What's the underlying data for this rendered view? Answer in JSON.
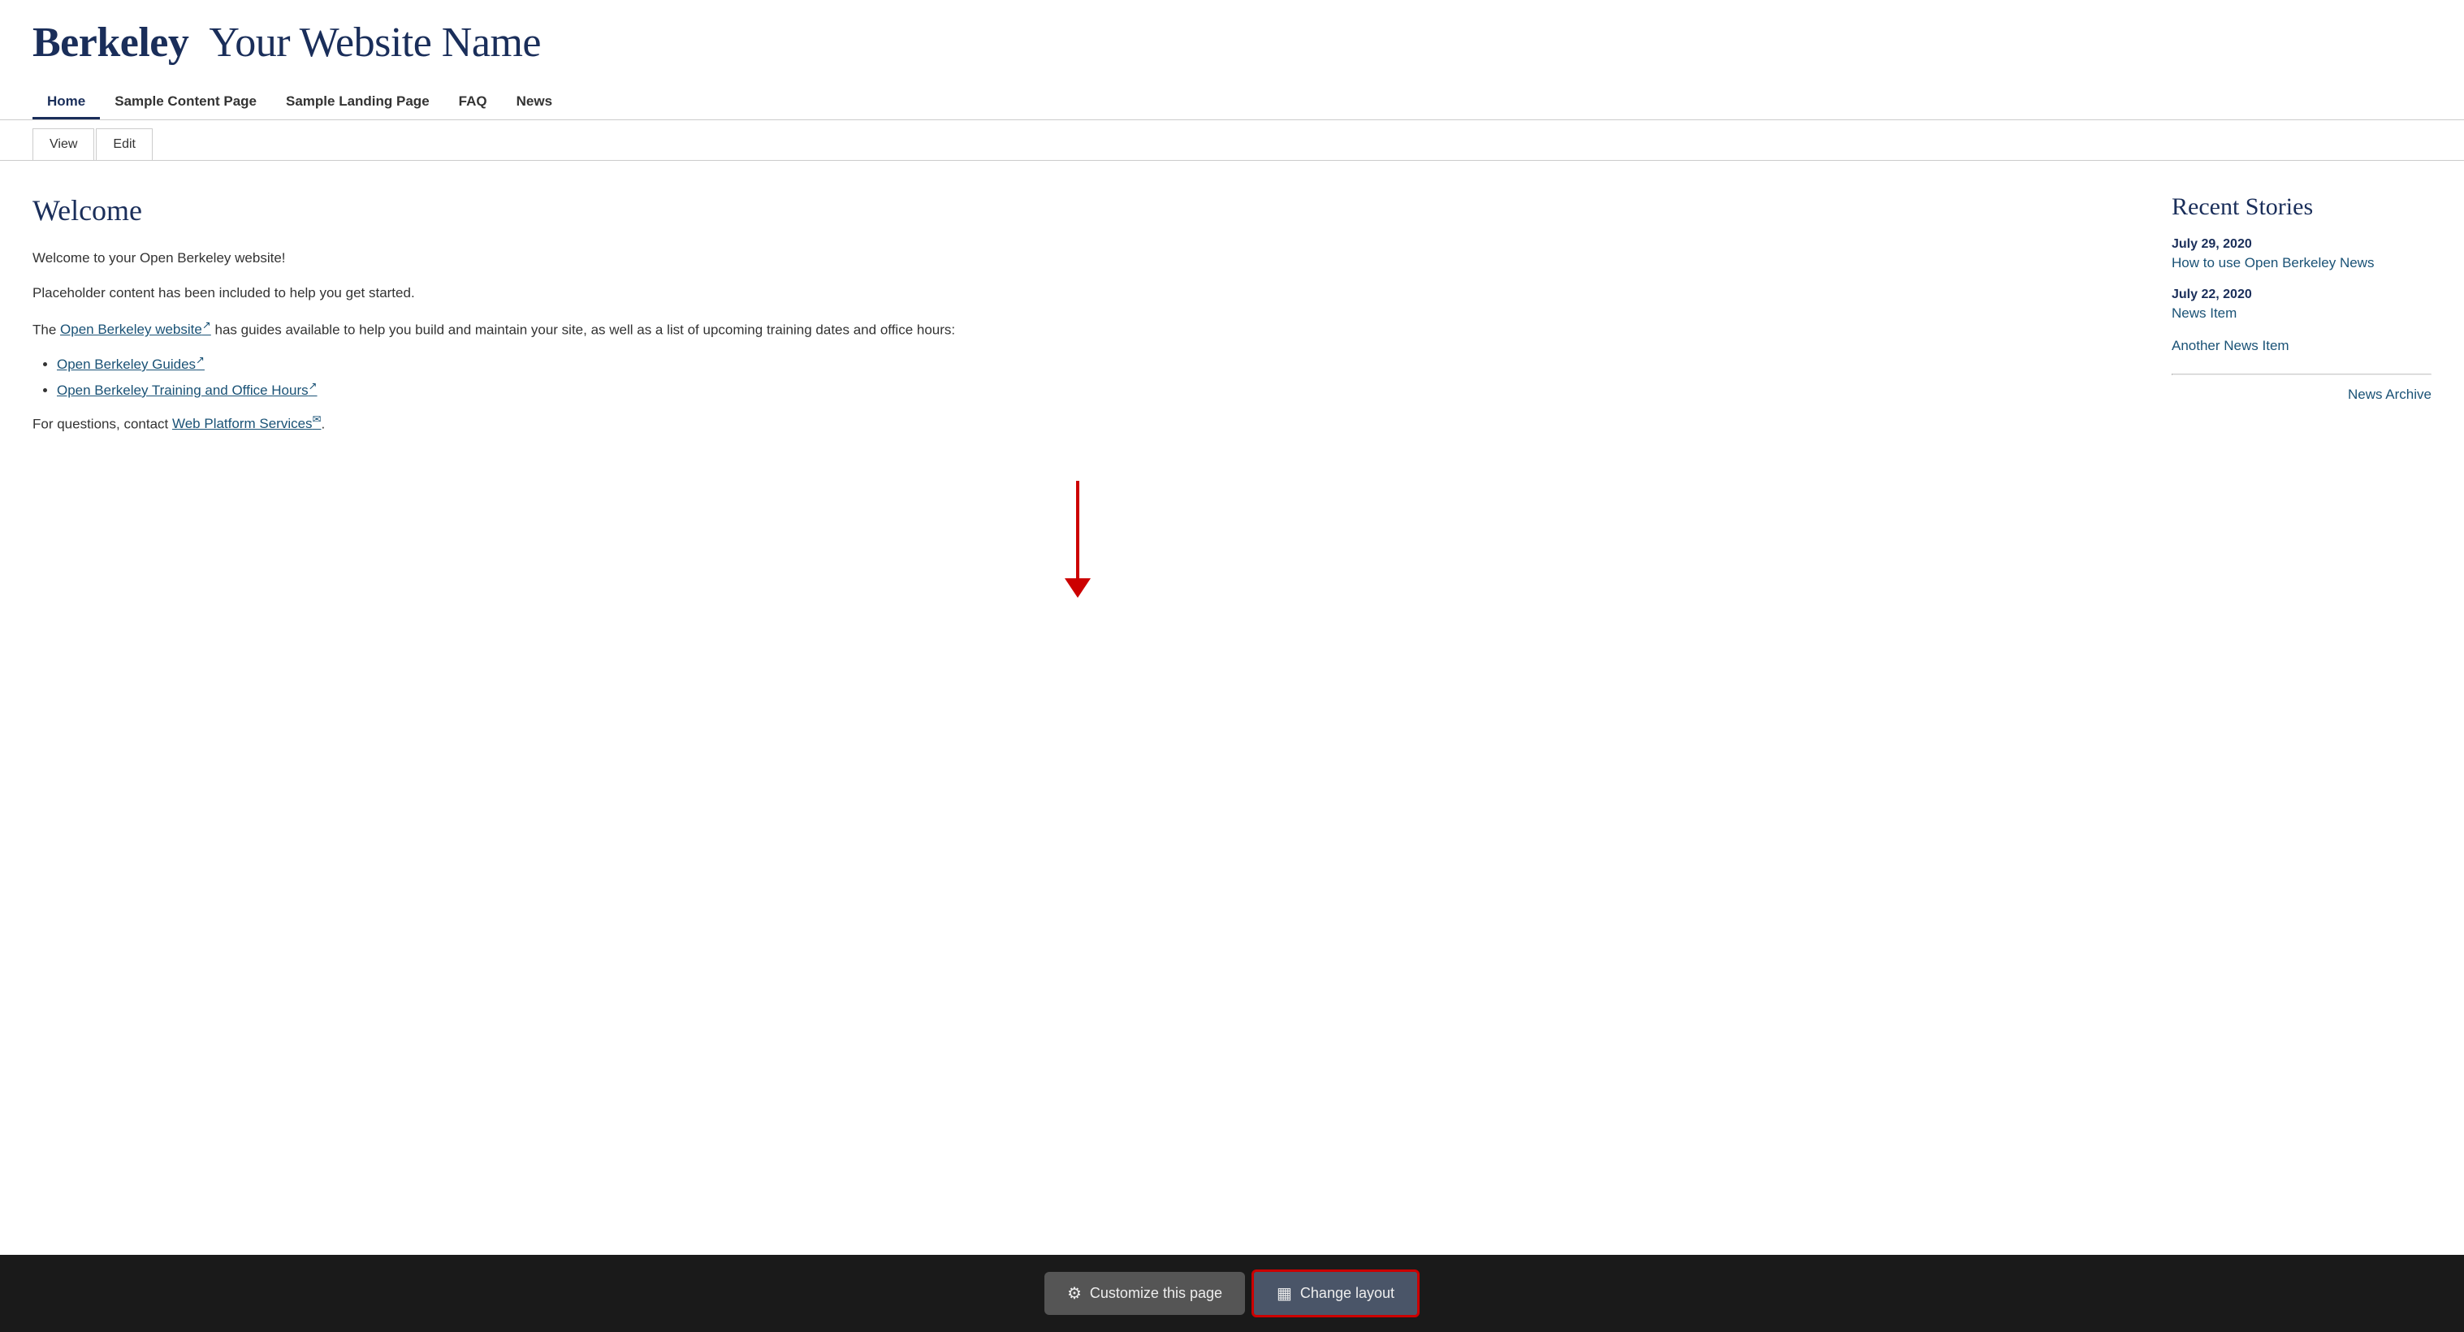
{
  "header": {
    "site_title_part1": "Berkeley",
    "site_title_part2": "Your Website Name"
  },
  "nav": {
    "items": [
      {
        "label": "Home",
        "active": true
      },
      {
        "label": "Sample Content Page",
        "active": false
      },
      {
        "label": "Sample Landing Page",
        "active": false
      },
      {
        "label": "FAQ",
        "active": false
      },
      {
        "label": "News",
        "active": false
      }
    ]
  },
  "tabs": [
    {
      "label": "View",
      "active": true
    },
    {
      "label": "Edit",
      "active": false
    }
  ],
  "main": {
    "heading": "Welcome",
    "para1": "Welcome to your Open Berkeley website!",
    "para2": "Placeholder content has been included to help you get started.",
    "para3_before": "The ",
    "para3_link": "Open Berkeley website",
    "para3_after": " has guides available to help you build and maintain your site, as well as a list of upcoming training dates and office hours:",
    "list_items": [
      {
        "label": "Open Berkeley Guides"
      },
      {
        "label": "Open Berkeley Training and Office Hours"
      }
    ],
    "contact_before": "For questions, contact ",
    "contact_link": "Web Platform Services",
    "contact_after": "."
  },
  "sidebar": {
    "heading": "Recent Stories",
    "stories": [
      {
        "date": "July 29, 2020",
        "title": "How to use Open Berkeley News"
      },
      {
        "date": "July 22, 2020",
        "title": "News Item"
      },
      {
        "date": "",
        "title": "Another News Item"
      }
    ],
    "archive_label": "News Archive"
  },
  "toolbar": {
    "customize_label": "Customize this page",
    "change_layout_label": "Change layout",
    "customize_icon": "⚙",
    "layout_icon": "▦"
  }
}
